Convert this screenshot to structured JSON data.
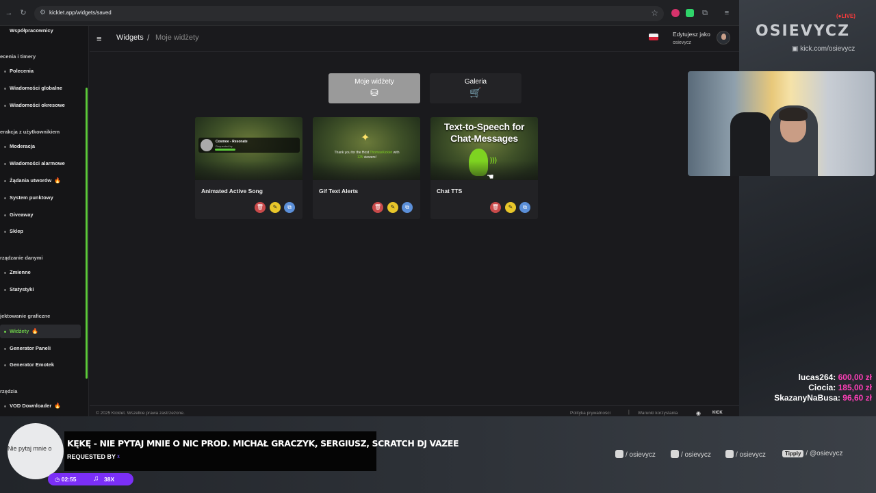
{
  "browser": {
    "url": "kicklet.app/widgets/saved"
  },
  "sidebar": {
    "top_item": "Współpracownicy",
    "sections": [
      {
        "title": "ecenia i timery",
        "items": [
          {
            "label": "Polecenia"
          },
          {
            "label": "Wiadomości globalne"
          },
          {
            "label": "Wiadomości okresowe"
          }
        ]
      },
      {
        "title": "erakcja z użytkownikiem",
        "items": [
          {
            "label": "Moderacja"
          },
          {
            "label": "Wiadomości alarmowe"
          },
          {
            "label": "Żądania utworów",
            "badge": "🔥"
          },
          {
            "label": "System punktowy"
          },
          {
            "label": "Giveaway"
          },
          {
            "label": "Sklep"
          }
        ]
      },
      {
        "title": "rządzanie danymi",
        "items": [
          {
            "label": "Zmienne"
          },
          {
            "label": "Statystyki"
          }
        ]
      },
      {
        "title": "jektowanie graficzne",
        "items": [
          {
            "label": "Widżety",
            "badge": "🔥",
            "active": true
          },
          {
            "label": "Generator Paneli"
          },
          {
            "label": "Generator Emotek"
          }
        ]
      },
      {
        "title": "rzędzia",
        "items": [
          {
            "label": "VOD Downloader",
            "badge": "🔥"
          }
        ]
      }
    ]
  },
  "header": {
    "breadcrumb_root": "Widgets",
    "breadcrumb_sep": "/",
    "breadcrumb_current": "Moje widżety",
    "user_label": "Edytujesz jako",
    "user_name": "osievycz"
  },
  "tabs": [
    {
      "label": "Moje widżety",
      "icon": "database-icon",
      "active": true
    },
    {
      "label": "Galeria",
      "icon": "cart-icon",
      "active": false
    }
  ],
  "widgets": [
    {
      "title": "Animated Active Song",
      "preview_song": "Cosmoe - Resonate",
      "preview_requested": "Requested by"
    },
    {
      "title": "Gif Text Alerts",
      "preview_text_1": "Thank you for the Host",
      "preview_host": "ThomasKicklet",
      "preview_text_2": "with",
      "preview_viewers": "125",
      "preview_text_3": "viewers!"
    },
    {
      "title": "Chat TTS",
      "preview_title": "Text-to-Speech for Chat-Messages"
    }
  ],
  "footer": {
    "copyright": "© 2025 Kicklet. Wszelkie prawa zastrzeżone.",
    "privacy": "Polityka prywatności",
    "separator": "|",
    "terms": "Warunki korzystania",
    "kick": "KICK"
  },
  "overlay": {
    "live": "(●LIVE)",
    "logo": "OSIEVYCZ",
    "kick_link": "kick.com/osievycz",
    "donors": [
      {
        "name": "lucas264:",
        "amount": "600,00 zł"
      },
      {
        "name": "Ciocia:",
        "amount": "185,00 zł"
      },
      {
        "name": "SkazanyNaBusa:",
        "amount": "96,60 zł"
      }
    ],
    "now_playing": {
      "disc_text": "Nie pytaj mnie o",
      "title": "KĘKĘ - NIE PYTAJ MNIE O NIC PROD. MICHAŁ GRACZYK, SERGIUSZ, SCRATCH DJ VAZEE",
      "requested_by": "REQUESTED BY",
      "time": "02:55",
      "count": "38X"
    },
    "socials": [
      {
        "icon": "instagram-icon",
        "label": "/ osievycz"
      },
      {
        "icon": "tiktok-icon",
        "label": "/ osievycz"
      },
      {
        "icon": "youtube-icon",
        "label": "/ osievycz"
      },
      {
        "badge": "Tipply",
        "label": "/ @osievycz"
      }
    ]
  },
  "colors": {
    "accent_green": "#6fd04a",
    "delete": "#c94a4a",
    "edit": "#e8c62a",
    "copy": "#5b8fd8",
    "donor_amount": "#ff3fb8",
    "now_playing_pill": "#7b2ff7"
  }
}
